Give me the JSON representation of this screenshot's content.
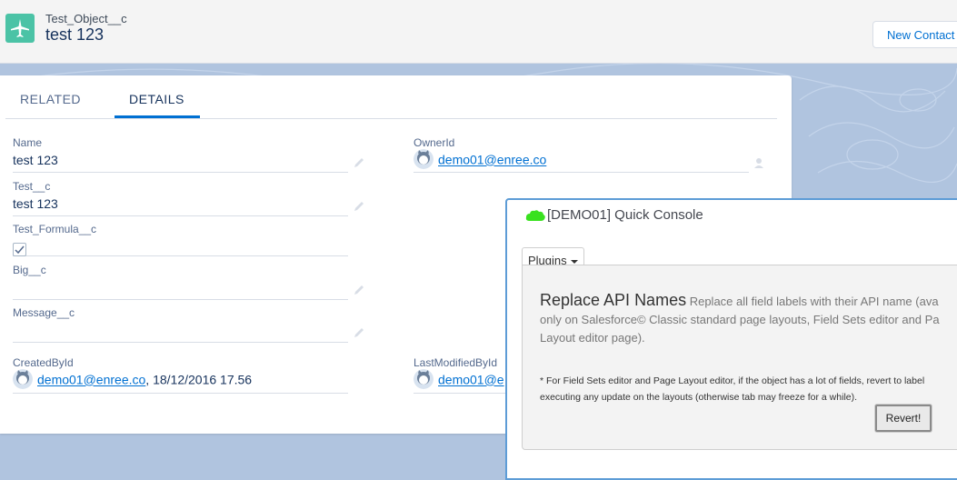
{
  "header": {
    "object_type": "Test_Object__c",
    "record_name": "test 123",
    "new_contact_label": "New Contact"
  },
  "tabs": [
    {
      "label": "RELATED",
      "active": false
    },
    {
      "label": "DETAILS",
      "active": true
    }
  ],
  "fields": {
    "name": {
      "label": "Name",
      "value": "test 123"
    },
    "owner": {
      "label": "OwnerId",
      "value": "demo01@enree.co"
    },
    "test_c": {
      "label": "Test__c",
      "value": "test 123"
    },
    "test_formula": {
      "label": "Test_Formula__c",
      "checked": true
    },
    "big_c": {
      "label": "Big__c",
      "value": ""
    },
    "message_c": {
      "label": "Message__c",
      "value": ""
    },
    "created_by": {
      "label": "CreatedById",
      "user": "demo01@enree.co",
      "suffix": ", 18/12/2016 17.56"
    },
    "last_modified": {
      "label": "LastModifiedById",
      "user": "demo01@e"
    }
  },
  "console": {
    "title": "[DEMO01] Quick Console",
    "plugins_label": "Plugins",
    "plugin_name": "Replace API Names",
    "plugin_desc_lines": [
      "Replace all field labels with their API name (ava",
      "only on Salesforce© Classic standard page layouts, Field Sets editor and Pa",
      "Layout editor page)."
    ],
    "plugin_note_lines": [
      "* For Field Sets editor and Page Layout editor, if the object has a lot of fields, revert to label",
      "executing any update on the layouts (otherwise tab may freeze for a while)."
    ],
    "revert_label": "Revert!"
  },
  "colors": {
    "accent": "#0070d2",
    "object_icon": "#4bc3a6",
    "background": "#b0c4df",
    "console_border": "#5d9cd6",
    "cloud_icon": "#39e11f"
  }
}
